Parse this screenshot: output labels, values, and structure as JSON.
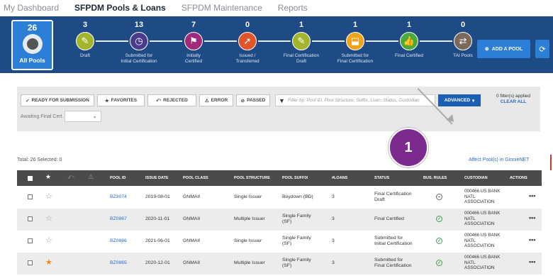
{
  "nav": {
    "tabs": [
      "My Dashboard",
      "SFPDM Pools & Loans",
      "SFPDM Maintenance",
      "Reports"
    ],
    "active": 1
  },
  "pipeline": {
    "all_pools": {
      "count": "26",
      "label": "All Pools"
    },
    "stages": [
      {
        "count": "3",
        "label1": "Draft",
        "label2": "",
        "color": "#a3b52a",
        "icon": "edit-icon",
        "glyph": "✎"
      },
      {
        "count": "13",
        "label1": "Submitted for",
        "label2": "Initial Certification",
        "color": "#4a3b8c",
        "icon": "clock-icon",
        "glyph": "◷"
      },
      {
        "count": "7",
        "label1": "Initially",
        "label2": "Certified",
        "color": "#a12a7a",
        "icon": "flag-icon",
        "glyph": "⚑"
      },
      {
        "count": "0",
        "label1": "Issued /",
        "label2": "Transferred",
        "color": "#e0562a",
        "icon": "export-icon",
        "glyph": "➚"
      },
      {
        "count": "1",
        "label1": "Final Certification",
        "label2": "Draft",
        "color": "#a3b52a",
        "icon": "edit-icon",
        "glyph": "✎"
      },
      {
        "count": "1",
        "label1": "Submitted for",
        "label2": "Final Certification",
        "color": "#f0a41a",
        "icon": "inbox-icon",
        "glyph": "⬓"
      },
      {
        "count": "1",
        "label1": "Final Certified",
        "label2": "",
        "color": "#4aaa3c",
        "icon": "thumbs-up-icon",
        "glyph": "👍"
      },
      {
        "count": "0",
        "label1": "TAI Pools",
        "label2": "",
        "color": "#7a6a5c",
        "icon": "transfer-icon",
        "glyph": "⇄"
      }
    ],
    "add_pool_label": "ADD A POOL",
    "refresh_icon": "refresh-icon"
  },
  "filters": {
    "buttons": [
      {
        "label": "READY FOR SUBMISSION",
        "glyph": "✓",
        "icon": "check-icon"
      },
      {
        "label": "FAVORITES",
        "glyph": "★",
        "icon": "star-icon"
      },
      {
        "label": "REJECTED",
        "glyph": "⤺",
        "icon": "reject-icon"
      },
      {
        "label": "ERROR",
        "glyph": "⚠",
        "icon": "warning-icon"
      },
      {
        "label": "PASSED",
        "glyph": "⊘",
        "icon": "passed-icon"
      }
    ],
    "search_placeholder": "Filter by: Pool ID, Pool Structure, Suffix, Loan, Status, Custodian",
    "advanced_label": "ADVANCED",
    "applied_text": "0 filter(s) applied",
    "clear_all": "CLEAR ALL",
    "awaiting_label": "Awaiting Final Cert."
  },
  "list": {
    "total_text": "Total: 26 Selected: 0",
    "affected_link": "Affect Pool(s) in GinnieNET",
    "badge_number": "1",
    "columns": [
      "POOL ID",
      "ISSUE DATE",
      "POOL CLASS",
      "POOL STRUCTURE",
      "POOL SUFFIX",
      "#LOANS",
      "STATUS",
      "BUS. RULES",
      "CUSTODIAN",
      "ACTIONS"
    ],
    "rows": [
      {
        "favorite": false,
        "pool_id": "BZ3074",
        "issue_date": "2019-08-01",
        "pool_class": "GNMAII",
        "structure": "Single Issuer",
        "suffix1": "Buydown (BD)",
        "suffix2": "",
        "loans": "3",
        "status1": "Final Certification",
        "status2": "Draft",
        "rules": "neutral",
        "cust1": "000466 US BANK",
        "cust2": "NATL",
        "cust3": "ASSOCIATION"
      },
      {
        "favorite": false,
        "pool_id": "BZ0867",
        "issue_date": "2020-11-01",
        "pool_class": "GNMAII",
        "structure": "Multiple Issuer",
        "suffix1": "Single Family",
        "suffix2": "(SF)",
        "loans": "3",
        "status1": "Final Certified",
        "status2": "",
        "rules": "ok",
        "cust1": "000466 US BANK",
        "cust2": "NATL",
        "cust3": "ASSOCIATION"
      },
      {
        "favorite": false,
        "pool_id": "BZ0866",
        "issue_date": "2021-06-01",
        "pool_class": "GNMAII",
        "structure": "Single Issuer",
        "suffix1": "Single Family",
        "suffix2": "(SF)",
        "loans": "3",
        "status1": "Submitted for",
        "status2": "Initial Certification",
        "rules": "ok",
        "cust1": "000466 US BANK",
        "cust2": "NATL",
        "cust3": "ASSOCIATION"
      },
      {
        "favorite": true,
        "pool_id": "BZ0865",
        "issue_date": "2020-12-01",
        "pool_class": "GNMAII",
        "structure": "Multiple Issuer",
        "suffix1": "Single Family",
        "suffix2": "(SF)",
        "loans": "3",
        "status1": "Submitted for",
        "status2": "Final Certification",
        "rules": "ok",
        "cust1": "000466 US BANK",
        "cust2": "NATL",
        "cust3": "ASSOCIATION"
      }
    ]
  }
}
